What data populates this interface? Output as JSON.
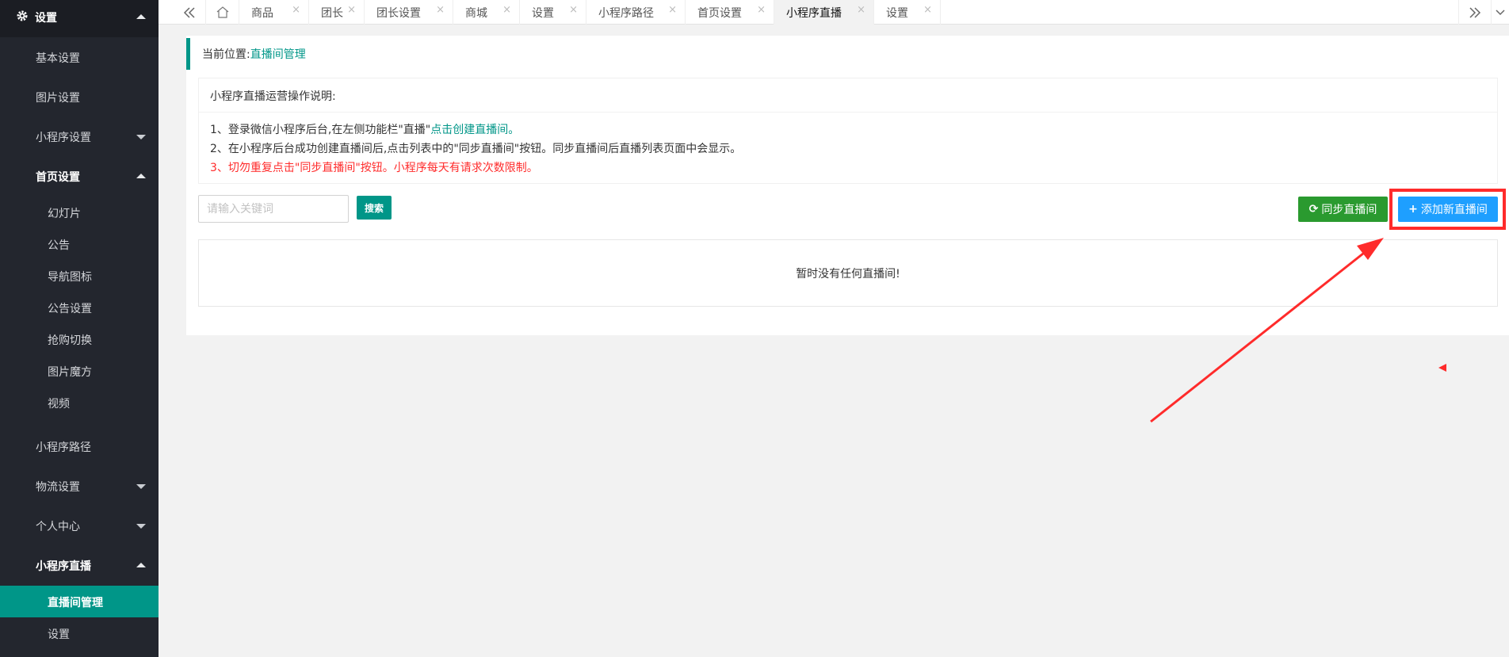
{
  "sidebar": {
    "top": {
      "label": "设置",
      "icon": "gear-icon"
    },
    "items": [
      {
        "label": "基本设置"
      },
      {
        "label": "图片设置"
      },
      {
        "label": "小程序设置"
      },
      {
        "label": "首页设置"
      },
      {
        "label": "幻灯片"
      },
      {
        "label": "公告"
      },
      {
        "label": "导航图标"
      },
      {
        "label": "公告设置"
      },
      {
        "label": "抢购切换"
      },
      {
        "label": "图片魔方"
      },
      {
        "label": "视频"
      },
      {
        "label": "小程序路径"
      },
      {
        "label": "物流设置"
      },
      {
        "label": "个人中心"
      },
      {
        "label": "小程序直播"
      },
      {
        "label": "直播间管理"
      },
      {
        "label": "设置"
      }
    ],
    "active_color": "#009688"
  },
  "tabs": [
    {
      "label": "商品"
    },
    {
      "label": "团长"
    },
    {
      "label": "团长设置"
    },
    {
      "label": "商城"
    },
    {
      "label": "设置"
    },
    {
      "label": "小程序路径"
    },
    {
      "label": "首页设置"
    },
    {
      "label": "小程序直播"
    },
    {
      "label": "设置"
    }
  ],
  "tabs_close_symbol": "×",
  "breadcrumb": {
    "label": "当前位置:",
    "current": "直播间管理"
  },
  "info": {
    "title": "小程序直播运营操作说明:",
    "line1_text": "1、登录微信小程序后台,在左侧功能栏\"直播\"",
    "line1_link": "点击创建直播间。",
    "line2": "2、在小程序后台成功创建直播间后,点击列表中的\"同步直播间\"按钮。同步直播间后直播列表页面中会显示。",
    "line3": "3、切勿重复点击\"同步直播间\"按钮。小程序每天有请求次数限制。"
  },
  "search": {
    "placeholder": "请输入关键词",
    "button": "搜索"
  },
  "actions": {
    "sync": {
      "icon": "⟳",
      "label": "同步直播间"
    },
    "add": {
      "icon": "+",
      "label": "添加新直播间"
    }
  },
  "empty_text": "暂时没有任何直播间!",
  "colors": {
    "primary": "#009688",
    "add": "#1e9fff",
    "sync": "#2a9a2f",
    "highlight": "#ff2b2b"
  }
}
